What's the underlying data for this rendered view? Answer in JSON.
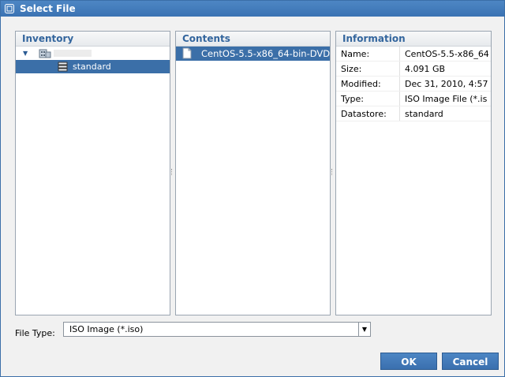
{
  "window": {
    "title": "Select File"
  },
  "inventory": {
    "header": "Inventory",
    "items": [
      {
        "label": ""
      },
      {
        "label": "standard"
      }
    ]
  },
  "contents": {
    "header": "Contents",
    "items": [
      {
        "label": "CentOS-5.5-x86_64-bin-DVD"
      }
    ]
  },
  "information": {
    "header": "Information",
    "rows": [
      {
        "key": "Name:",
        "value": "CentOS-5.5-x86_64"
      },
      {
        "key": "Size:",
        "value": "4.091 GB"
      },
      {
        "key": "Modified:",
        "value": "Dec 31, 2010, 4:57"
      },
      {
        "key": "Type:",
        "value": "ISO Image File (*.is"
      },
      {
        "key": "Datastore:",
        "value": "standard"
      }
    ]
  },
  "file_type": {
    "label": "File Type:",
    "selected": "ISO Image (*.iso)"
  },
  "buttons": {
    "ok": "OK",
    "cancel": "Cancel"
  },
  "icons": {
    "window": "vsphere-icon",
    "datacenter": "datacenter-icon",
    "datastore": "datastore-icon",
    "file": "file-icon",
    "expand": "triangle-down-icon",
    "dropdown": "triangle-down-icon"
  },
  "colors": {
    "accent": "#3b6fa8",
    "header_text": "#33659d"
  }
}
